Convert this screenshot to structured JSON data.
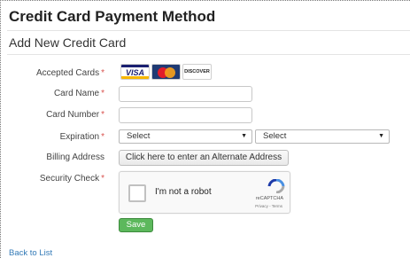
{
  "page": {
    "title": "Credit Card Payment Method"
  },
  "form": {
    "section_title": "Add New Credit Card",
    "required_marker": "*",
    "accepted_cards": {
      "label": "Accepted Cards",
      "cards": [
        {
          "name": "VISA",
          "icon": "visa-card-icon",
          "colors": [
            "#1a1f71",
            "#f7b600"
          ]
        },
        {
          "name": "MasterCard",
          "icon": "mastercard-icon",
          "colors": [
            "#e21b2a",
            "#f59f1b"
          ]
        },
        {
          "name": "DISCOVER",
          "icon": "discover-card-icon",
          "colors": [
            "#f58220"
          ]
        }
      ]
    },
    "card_name": {
      "label": "Card Name",
      "value": ""
    },
    "card_number": {
      "label": "Card Number",
      "value": ""
    },
    "expiration": {
      "label": "Expiration",
      "month_value": "Select",
      "year_value": "Select"
    },
    "billing": {
      "label": "Billing Address",
      "button_label": "Click here to enter an Alternate Address"
    },
    "security": {
      "label": "Security Check",
      "captcha_text": "I'm not a robot",
      "captcha_brand": "reCAPTCHA",
      "captcha_terms": "Privacy - Terms"
    },
    "save_label": "Save"
  },
  "footer": {
    "back_link": "Back to List"
  },
  "colors": {
    "accent_link": "#337ab7",
    "save_button": "#5cb85c",
    "required": "#d9534f"
  }
}
